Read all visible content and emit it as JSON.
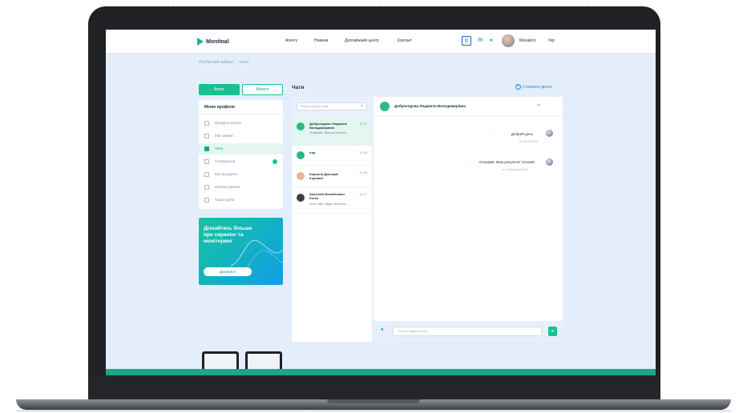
{
  "header": {
    "logo": "Monitoal",
    "nav": [
      "Агенту",
      "Новини",
      "Допоміжний центр",
      "Контакт"
    ],
    "user_name": "Михайло",
    "lang": "Укр"
  },
  "breadcrumb": "Особистий кабінет → Чати",
  "sidebar": {
    "buy_label": "Агент",
    "sell_label": "Версія",
    "menu_title": "Меню профілю",
    "items": [
      {
        "label": "Профіль агента"
      },
      {
        "label": "Мої заявки"
      },
      {
        "label": "Чати"
      },
      {
        "label": "Сповіщення"
      },
      {
        "label": "Мої продукти"
      },
      {
        "label": "Налаштування"
      },
      {
        "label": "Наша група"
      }
    ],
    "active_index": 2,
    "promo_text": "Дізнайтесь більше про скринінг та моніторинг",
    "promo_button": "Дізнатися"
  },
  "chats": {
    "title": "Чати",
    "support_label": "Створити діалог",
    "search_placeholder": "Пошук серед чатів",
    "list": [
      {
        "name": "Доброходова Людмила Володимирівна",
        "time": "10:37",
        "preview": "Отримав. Ваш результат…",
        "color": "#2cb988"
      },
      {
        "name": "Ігор",
        "time": "10:28",
        "preview": "",
        "color": "#27b487"
      },
      {
        "name": "Кирилов Дмитрий Ігоревич",
        "time": "10:28",
        "preview": "",
        "color": "#e4b89f"
      },
      {
        "name": "Анатолій Михайлович Котик",
        "time": "10:27",
        "preview": "Котя хайт, будь ласка пр…",
        "color": "#3a3f48"
      }
    ]
  },
  "conversation": {
    "name": "Доброходова Людмила Володимирівна",
    "messages": [
      {
        "text": "Добрий день",
        "time": "вч, 10:27 2023"
      },
      {
        "text": "Отримав. Ваш результат готовий",
        "time": "вч, 10:35 вчора 2023"
      }
    ],
    "input_placeholder": "Текст повідомлення"
  },
  "colors": {
    "accent": "#16c290",
    "blue": "#1c8fd6",
    "bg": "#e4eefb"
  }
}
